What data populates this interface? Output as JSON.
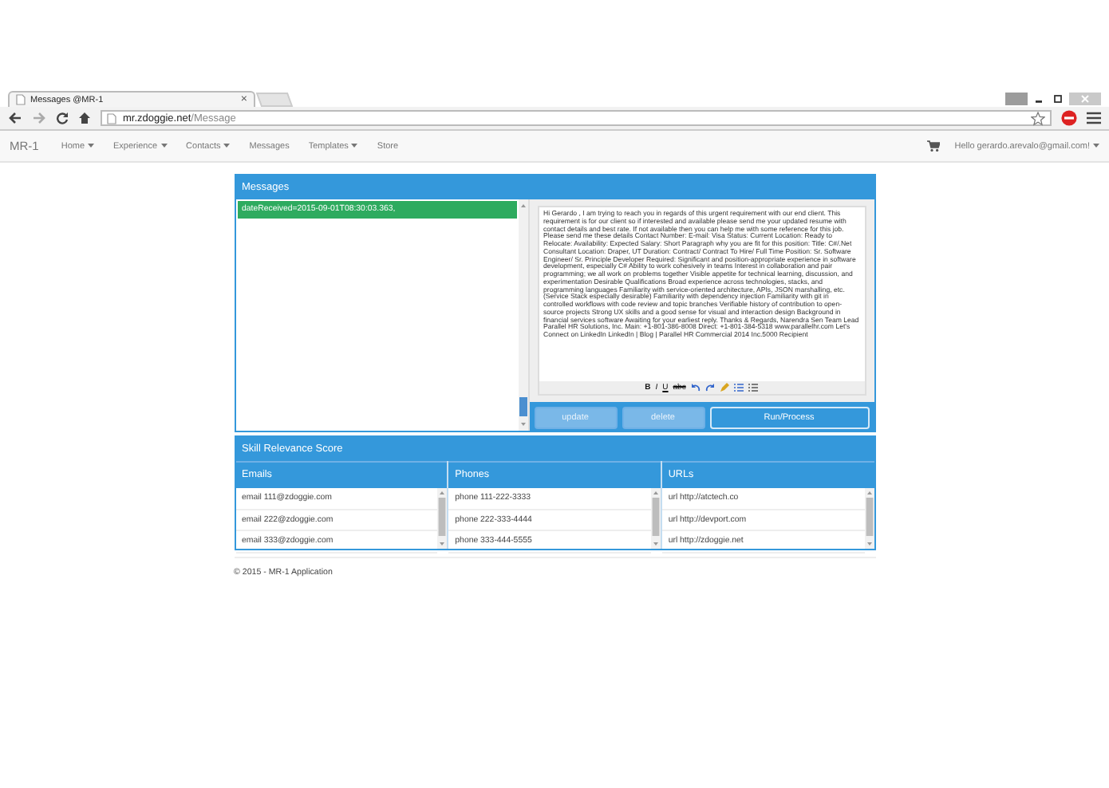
{
  "browser": {
    "tab_title": "Messages @MR-1",
    "tab_close": "×",
    "address_host": "mr.zdoggie.net",
    "address_path": "/Message"
  },
  "navbar": {
    "brand": "MR-1",
    "items": [
      {
        "label": "Home",
        "dropdown": true
      },
      {
        "label": "Experience",
        "dropdown": true
      },
      {
        "label": "Contacts",
        "dropdown": true
      },
      {
        "label": "Messages",
        "dropdown": false
      },
      {
        "label": "Templates",
        "dropdown": true
      },
      {
        "label": "Store",
        "dropdown": false
      }
    ],
    "user": "Hello gerardo.arevalo@gmail.com!"
  },
  "messages_panel": {
    "title": "Messages",
    "items": [
      {
        "label": "dateReceived=2015-09-01T08:30:03.363,",
        "selected": true
      }
    ],
    "body": "Hi Gerardo , I am trying to reach you in regards of this urgent requirement with our end client. This requirement is for our client so if interested and available please send me your updated resume with contact details and best rate. If not available then you can help me with some reference for this job. Please send me these details Contact Number: E-mail: Visa Status: Current Location: Ready to Relocate: Availability: Expected Salary: Short Paragraph why you are fit for this position: Title: C#/.Net Consultant Location: Draper, UT Duration: Contract/ Contract To Hire/ Full Time Position: Sr. Software Engineer/ Sr. Principle Developer Required: Significant and position-appropriate experience in software development, especially C# Ability to work cohesively in teams Interest in collaboration and pair programming; we all work on problems together Visible appetite for technical learning, discussion, and experimentation Desirable Qualifications Broad experience across technologies, stacks, and programming languages Familiarity with service-oriented architecture, APIs, JSON marshalling, etc. (Service Stack especially desirable) Familiarity with dependency injection Familiarity with git in controlled workflows with code review and topic branches Verifiable history of contribution to open-source projects Strong UX skills and a good sense for visual and interaction design Background in financial services software Awaiting for your earliest reply. Thanks & Regards, Narendra Sen Team Lead Parallel HR Solutions, Inc. Main: +1-801-386-8008 Direct: +1-801-384-5318 www.parallelhr.com Let's Connect on LinkedIn LinkedIn | Blog | Parallel HR Commercial 2014 Inc.5000 Recipient",
    "format_buttons": [
      {
        "label": "B",
        "kind": "bold"
      },
      {
        "label": "I",
        "kind": "italic"
      },
      {
        "label": "U",
        "kind": "underline"
      },
      {
        "label": "abc",
        "kind": "strike"
      }
    ],
    "buttons": [
      {
        "label": "update",
        "disabled": true
      },
      {
        "label": "delete",
        "disabled": true
      },
      {
        "label": "Run/Process",
        "disabled": false
      }
    ]
  },
  "skill_panel": {
    "title": "Skill Relevance Score",
    "columns": [
      {
        "heading": "Emails",
        "rows": [
          "email 111@zdoggie.com",
          "email 222@zdoggie.com",
          "email 333@zdoggie.com"
        ]
      },
      {
        "heading": "Phones",
        "rows": [
          "phone 111-222-3333",
          "phone 222-333-4444",
          "phone 333-444-5555"
        ]
      },
      {
        "heading": "URLs",
        "rows": [
          "url http://atctech.co",
          "url http://devport.com",
          "url http://zdoggie.net"
        ]
      }
    ]
  },
  "footer": "© 2015 - MR-1 Application"
}
